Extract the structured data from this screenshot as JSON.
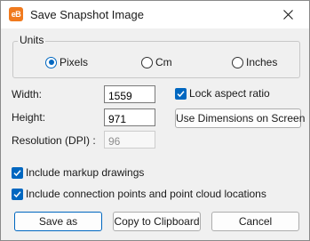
{
  "window": {
    "title": "Save Snapshot Image",
    "app_icon_text": "eB"
  },
  "units": {
    "legend": "Units",
    "options": [
      {
        "label": "Pixels",
        "checked": true
      },
      {
        "label": "Cm",
        "checked": false
      },
      {
        "label": "Inches",
        "checked": false
      }
    ]
  },
  "dimensions": {
    "width_label": "Width:",
    "width_value": "1559",
    "height_label": "Height:",
    "height_value": "971",
    "resolution_label": "Resolution (DPI) :",
    "resolution_value": "96"
  },
  "lock_aspect": {
    "label": "Lock aspect ratio",
    "checked": true
  },
  "use_dimensions_button": "Use Dimensions on Screen",
  "options": {
    "include_markup": {
      "label": "Include markup drawings",
      "checked": true
    },
    "include_connection": {
      "label": "Include connection points and point cloud locations",
      "checked": true
    }
  },
  "buttons": {
    "save_as": "Save as",
    "copy": "Copy to Clipboard",
    "cancel": "Cancel"
  },
  "colors": {
    "accent": "#0067c0",
    "app_icon": "#f07a1e"
  }
}
